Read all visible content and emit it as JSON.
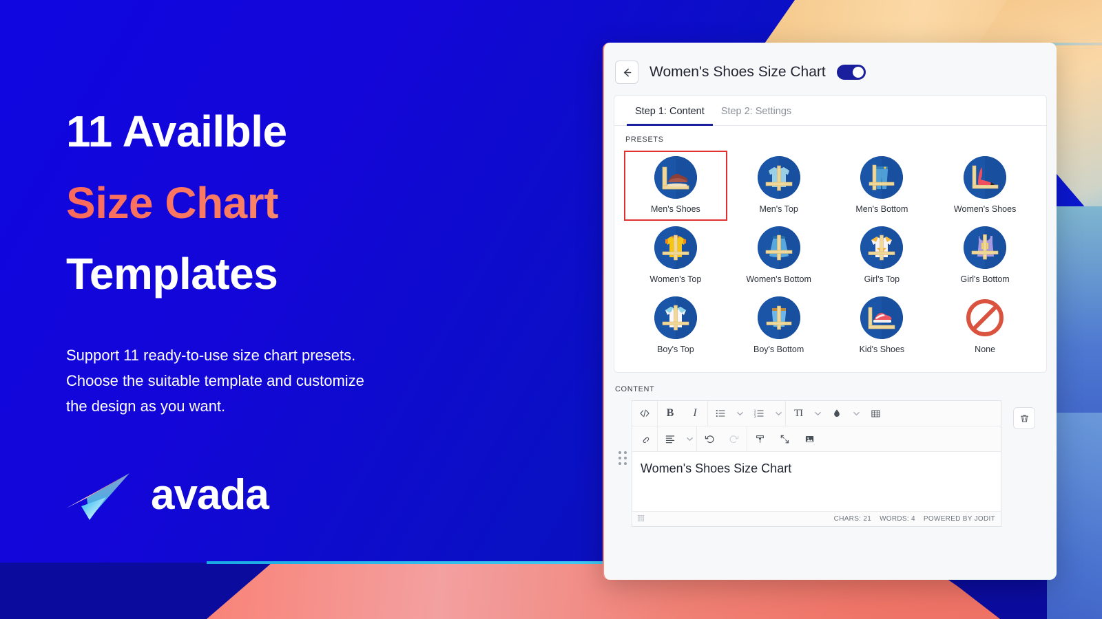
{
  "promo": {
    "headline_line1": "11 Availble",
    "headline_line2": "Size Chart",
    "headline_line3": "Templates",
    "body_line1": "Support 11 ready-to-use size chart presets.",
    "body_line2": "Choose the suitable template and customize",
    "body_line3": "the design as you want.",
    "logo_text": "avada",
    "headline_gradient_from": "#f96a5c",
    "headline_gradient_to": "#fbd49e",
    "background_color": "#0a17cf"
  },
  "app": {
    "back_icon": "arrow-left-icon",
    "title": "Women's Shoes Size Chart",
    "enabled_toggle": true,
    "toggle_color": "#1a1f9e",
    "tabs": [
      {
        "label": "Step 1: Content",
        "active": true
      },
      {
        "label": "Step 2: Settings",
        "active": false
      }
    ],
    "presets_label": "PRESETS",
    "presets": [
      {
        "label": "Men's Shoes",
        "icon": "mens-shoe-icon",
        "selected": true
      },
      {
        "label": "Men's Top",
        "icon": "mens-shirt-icon",
        "selected": false
      },
      {
        "label": "Men's Bottom",
        "icon": "mens-jeans-icon",
        "selected": false
      },
      {
        "label": "Women's Shoes",
        "icon": "high-heel-icon",
        "selected": false
      },
      {
        "label": "Women's Top",
        "icon": "womens-tshirt-icon",
        "selected": false
      },
      {
        "label": "Women's Bottom",
        "icon": "womens-skirt-icon",
        "selected": false
      },
      {
        "label": "Girl's Top",
        "icon": "girls-tshirt-icon",
        "selected": false
      },
      {
        "label": "Girl's Bottom",
        "icon": "girls-overall-icon",
        "selected": false
      },
      {
        "label": "Boy's Top",
        "icon": "boys-tshirt-icon",
        "selected": false
      },
      {
        "label": "Boy's Bottom",
        "icon": "boys-shorts-icon",
        "selected": false
      },
      {
        "label": "Kid's Shoes",
        "icon": "kids-sneaker-icon",
        "selected": false
      },
      {
        "label": "None",
        "icon": "prohibition-icon",
        "selected": false
      }
    ],
    "selected_preset_outline_color": "#e03030",
    "preset_circle_color": "#1b55a8",
    "content_label": "CONTENT",
    "editor": {
      "toolbar_row1": [
        {
          "name": "source-code-icon",
          "glyph": "</>"
        },
        {
          "name": "bold-icon",
          "glyph": "B"
        },
        {
          "name": "italic-icon",
          "glyph": "I"
        },
        {
          "name": "unordered-list-icon",
          "glyph": "list"
        },
        {
          "name": "ordered-list-icon",
          "glyph": "numlist"
        },
        {
          "name": "font-size-icon",
          "glyph": "TI"
        },
        {
          "name": "text-color-icon",
          "glyph": "droplet"
        },
        {
          "name": "table-icon",
          "glyph": "table"
        }
      ],
      "toolbar_row2": [
        {
          "name": "link-icon",
          "glyph": "link"
        },
        {
          "name": "align-icon",
          "glyph": "align"
        },
        {
          "name": "undo-icon",
          "glyph": "undo"
        },
        {
          "name": "redo-icon",
          "glyph": "redo",
          "disabled": true
        },
        {
          "name": "format-brush-icon",
          "glyph": "brush"
        },
        {
          "name": "fullscreen-icon",
          "glyph": "expand"
        },
        {
          "name": "image-icon",
          "glyph": "image"
        }
      ],
      "body_text": "Women's Shoes Size Chart",
      "status_chars": "CHARS: 21",
      "status_words": "WORDS: 4",
      "status_powered": "POWERED BY JODIT",
      "resize_icon": "resize-handle-icon"
    },
    "delete_icon": "trash-icon",
    "drag_handle_icon": "drag-dots-icon"
  }
}
